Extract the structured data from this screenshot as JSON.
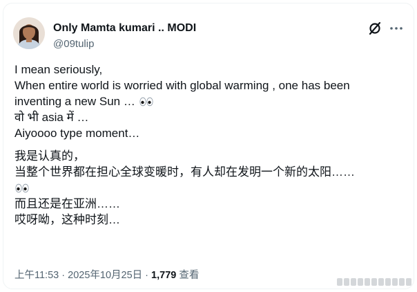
{
  "author": {
    "display_name": "Only Mamta kumari .. MODI",
    "handle": "@09tulip"
  },
  "tweet": {
    "lines_en": [
      "I mean seriously,",
      "When entire world is worried with global warming , one has been",
      "inventing a new Sun …",
      "वो भी asia में …",
      "Aiyoooo type moment…"
    ],
    "lines_zh": [
      "我是认真的，",
      "当整个世界都在担心全球变暖时，有人却在发明一个新的太阳……",
      "",
      "而且还是在亚洲……",
      "哎呀呦，这种时刻…"
    ]
  },
  "meta": {
    "time": "上午11:53",
    "separator": "·",
    "date": "2025年10月25日",
    "views_count": "1,779",
    "views_label": "查看"
  },
  "icons": {
    "grok": "grok-icon",
    "more": "more-icon",
    "eyes": "eyes-emoji"
  },
  "colors": {
    "text": "#0f1419",
    "secondary": "#536471",
    "border": "#eff3f4"
  }
}
